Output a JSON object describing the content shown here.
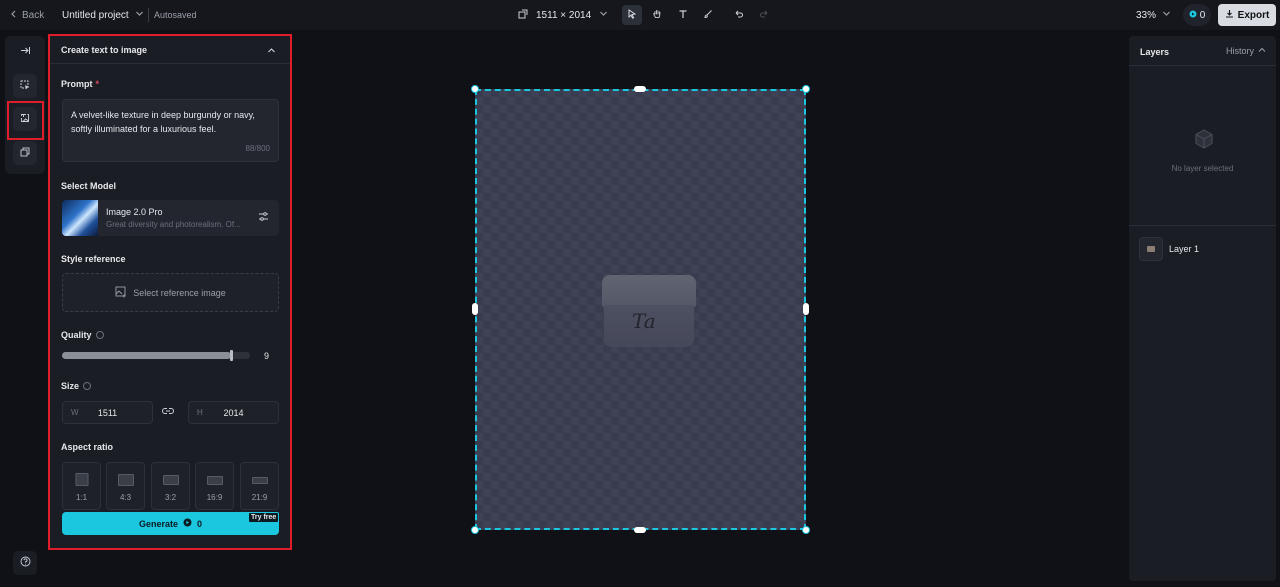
{
  "topbar": {
    "back_label": "Back",
    "project_name": "Untitled project",
    "save_status": "Autosaved",
    "canvas_size": "1511 × 2014",
    "zoom": "33%",
    "credits": "0",
    "export_label": "Export"
  },
  "panel": {
    "title": "Create text to image",
    "prompt_label": "Prompt",
    "prompt_required": "*",
    "prompt_text": "A velvet-like texture in deep burgundy or navy, softly illuminated for a luxurious feel.",
    "prompt_counter": "88/800",
    "model_label": "Select Model",
    "model_name": "Image 2.0 Pro",
    "model_desc": "Great diversity and photorealism. Of...",
    "style_label": "Style reference",
    "style_button": "Select reference image",
    "quality_label": "Quality",
    "quality_value": "9",
    "quality_fraction": 0.9,
    "size_label": "Size",
    "width_letter": "W",
    "width_value": "1511",
    "height_letter": "H",
    "height_value": "2014",
    "aspect_label": "Aspect ratio",
    "aspect_ratios": [
      "1:1",
      "4:3",
      "3:2",
      "16:9",
      "21:9"
    ],
    "generate_label": "Generate",
    "generate_cost": "0",
    "try_free": "Try free"
  },
  "layers": {
    "title": "Layers",
    "history_label": "History",
    "empty_text": "No layer selected",
    "items": [
      {
        "name": "Layer 1"
      }
    ]
  },
  "canvas": {
    "logo_text": "Ta"
  },
  "colors": {
    "accent": "#1ac7de",
    "highlight": "#e01e2b",
    "background": "#0f1116",
    "panel": "#1a1d23"
  }
}
